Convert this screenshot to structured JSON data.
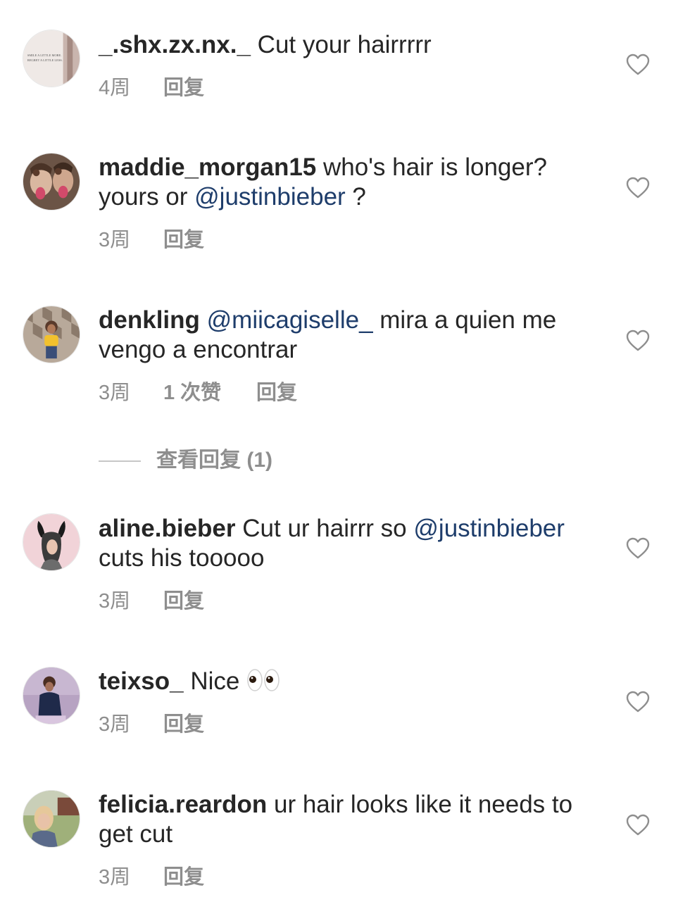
{
  "comments": [
    {
      "username": "_.shx.zx.nx._",
      "text_before": " Cut your hairrrrr",
      "mention": "",
      "text_after": "",
      "avatar_text_line1": "SMILE A LITTLE MORE.",
      "avatar_text_line2": "REGRET A LITTLE LESS.",
      "time": "4周",
      "likes": "",
      "reply_label": "回复"
    },
    {
      "username": "maddie_morgan15",
      "text_before": " who's hair is longer? yours or ",
      "mention": "@justinbieber",
      "text_after": " ?",
      "time": "3周",
      "likes": "",
      "reply_label": "回复"
    },
    {
      "username": "denkling",
      "text_before": " ",
      "mention": "@miicagiselle_",
      "text_after": " mira a quien me vengo a encontrar",
      "time": "3周",
      "likes": "1 次赞",
      "reply_label": "回复"
    },
    {
      "username": "aline.bieber",
      "text_before": " Cut ur hairrr so ",
      "mention": "@justinbieber",
      "text_after": " cuts his tooooo",
      "time": "3周",
      "likes": "",
      "reply_label": "回复"
    },
    {
      "username": "teixso_",
      "text_before": " Nice ",
      "mention": "",
      "text_after": "",
      "emoji": "eyes-emoji",
      "time": "3周",
      "likes": "",
      "reply_label": "回复"
    },
    {
      "username": "felicia.reardon",
      "text_before": " ur hair looks like it needs to get cut",
      "mention": "",
      "text_after": "",
      "time": "3周",
      "likes": "",
      "reply_label": "回复"
    }
  ],
  "view_replies_label": "查看回复 (1)",
  "icons": {
    "like": "heart-outline-icon"
  },
  "colors": {
    "text": "#262626",
    "secondary": "#8e8e8e",
    "mention": "#1e3d6b",
    "heart_stroke": "#8e8e8e"
  }
}
